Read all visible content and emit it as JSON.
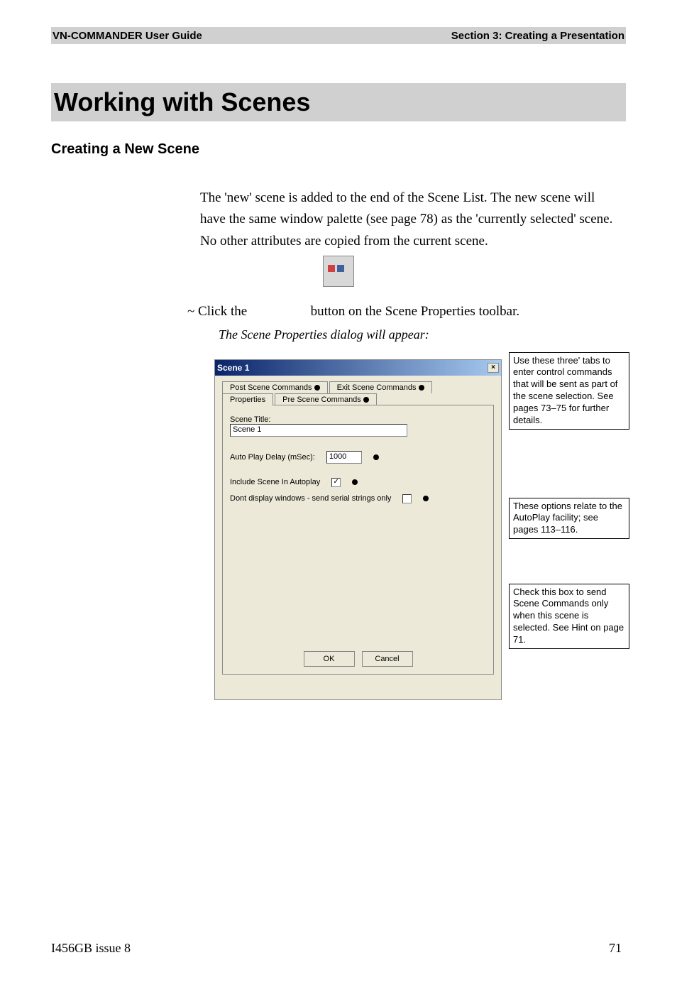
{
  "header": {
    "left": "VN-COMMANDER User Guide",
    "right": "Section 3: Creating a Presentation"
  },
  "main_title": "Working with Scenes",
  "sub_title": "Creating a New Scene",
  "body_para": "The 'new' scene is added to the end of the Scene List. The new scene will have the same window palette (see page 78) as the 'currently selected' scene. No other attributes are copied from the current scene.",
  "instruction_prefix": "~ Click the",
  "instruction_suffix": " button on the Scene Properties toolbar.",
  "italic_line": "The Scene Properties dialog will appear:",
  "dialog": {
    "title": "Scene 1",
    "close": "×",
    "tabs": {
      "post": "Post Scene Commands",
      "exit": "Exit Scene Commands",
      "properties": "Properties",
      "pre": "Pre Scene Commands"
    },
    "scene_title_label": "Scene Title:",
    "scene_title_value": "Scene 1",
    "autoplay_delay_label": "Auto Play Delay (mSec):",
    "autoplay_delay_value": "1000",
    "include_autoplay_label": "Include Scene In Autoplay",
    "include_autoplay_checked": "✓",
    "dont_display_label": "Dont display windows - send serial strings only",
    "ok": "OK",
    "cancel": "Cancel"
  },
  "annotations": {
    "a1": "Use these three' tabs to enter control commands that will be sent as part of the scene selection. See pages 73–75 for further details.",
    "a2": "These options relate to the AutoPlay facility; see pages 113–116.",
    "a3": "Check this box to send Scene Commands only when this scene is selected. See Hint on page 71."
  },
  "footer": {
    "left": "I456GB issue 8",
    "right": "71"
  }
}
